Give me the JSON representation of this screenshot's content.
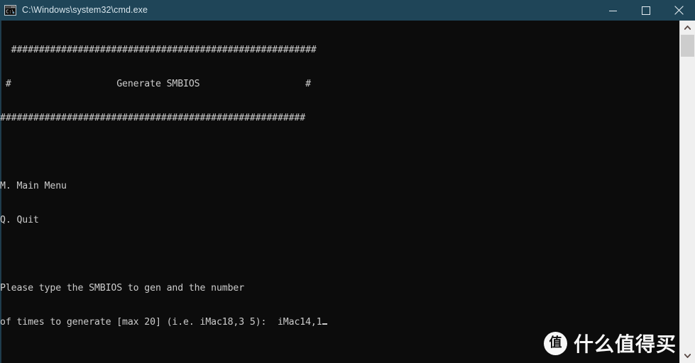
{
  "window": {
    "title": "C:\\Windows\\system32\\cmd.exe",
    "icon": "cmd-console-icon",
    "titlebar_color": "#1f4558",
    "console_background": "#0c0c0c",
    "console_foreground": "#cccccc"
  },
  "titlebar_buttons": {
    "minimize": "minimize-button",
    "maximize": "maximize-button",
    "close": "close-button"
  },
  "console": {
    "lines": [
      "  #######################################################",
      " #                   Generate SMBIOS                   #",
      "#######################################################",
      "",
      "M. Main Menu",
      "Q. Quit",
      "",
      "Please type the SMBIOS to gen and the number",
      "of times to generate [max 20] (i.e. iMac18,3 5):  "
    ],
    "banner_title": "Generate SMBIOS",
    "menu_items": [
      "M. Main Menu",
      "Q. Quit"
    ],
    "prompt_line_1": "Please type the SMBIOS to gen and the number",
    "prompt_line_2": "of times to generate [max 20] (i.e. iMac18,3 5):  ",
    "input_value": "iMac14,1",
    "cursor": "_"
  },
  "scrollbar": {
    "up_arrow": "chevron-up-icon",
    "down_arrow": "chevron-down-icon",
    "track_color": "#f0f0f0",
    "thumb_color": "#cdcdcd"
  },
  "watermark": {
    "logo_char": "值",
    "text": "什么值得买"
  }
}
